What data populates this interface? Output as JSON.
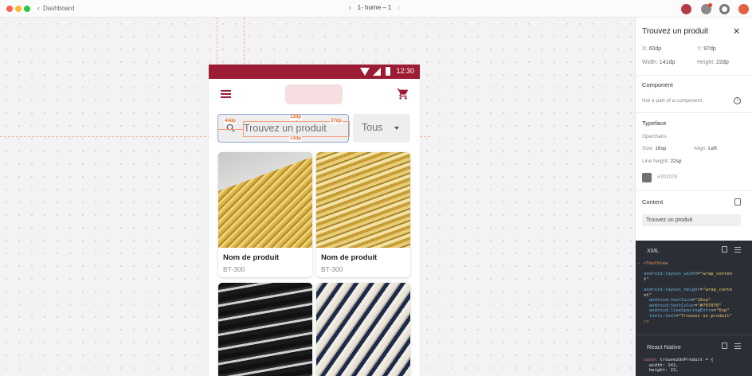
{
  "topbar": {
    "back_label": "Dashboard",
    "screen_name": "1- home – 1"
  },
  "phone": {
    "status_time": "12:30",
    "search_placeholder": "Trouvez un produit",
    "select_value": "Tous",
    "measurements": {
      "top": "13dp",
      "bottom": "13dp",
      "left": "44dp",
      "right": "37dp"
    },
    "products": [
      {
        "name": "Nom de produit",
        "sku": "BT-300"
      },
      {
        "name": "Nom de produit",
        "sku": "BT-300"
      },
      {
        "name": "",
        "sku": ""
      },
      {
        "name": "",
        "sku": ""
      }
    ]
  },
  "inspector": {
    "title": "Trouvez un produit",
    "x_label": "X:",
    "x_value": "60dp",
    "y_label": "Y:",
    "y_value": "97dp",
    "width_label": "Width:",
    "width_value": "141dp",
    "height_label": "Height:",
    "height_value": "22dp",
    "component_heading": "Component",
    "component_note": "Not a part of a component.",
    "typeface_heading": "Typeface",
    "font_name": "OpenSans",
    "size_label": "Size:",
    "size_value": "16sp",
    "align_label": "Align:",
    "align_value": "Left",
    "line_height_label": "Line height:",
    "line_height_value": "22sp",
    "color_hex": "#707070",
    "content_heading": "Content",
    "content_value": "Trouvez un produit",
    "xml_heading": "XML",
    "react_heading": "React Native"
  },
  "xml_code": [
    "<TextView",
    "",
    "android:layout_width=\"wrap_conten",
    "t\"",
    "",
    "android:layout_height=\"wrap_conte",
    "nt\"",
    "  android:textSize=\"16sp\"",
    "  android:textColor=\"#707070\"",
    "  android:lineSpacingExtra=\"6sp\"",
    "  tools:text=\"Trouvez un produit\"",
    "/>"
  ],
  "rn_code": [
    "const trouvezUnProduit = {",
    "  width: 141,",
    "  height: 22,"
  ],
  "colors": {
    "brand": "#9c1d33",
    "text_gray": "#707070",
    "measure": "#e06a2c"
  }
}
